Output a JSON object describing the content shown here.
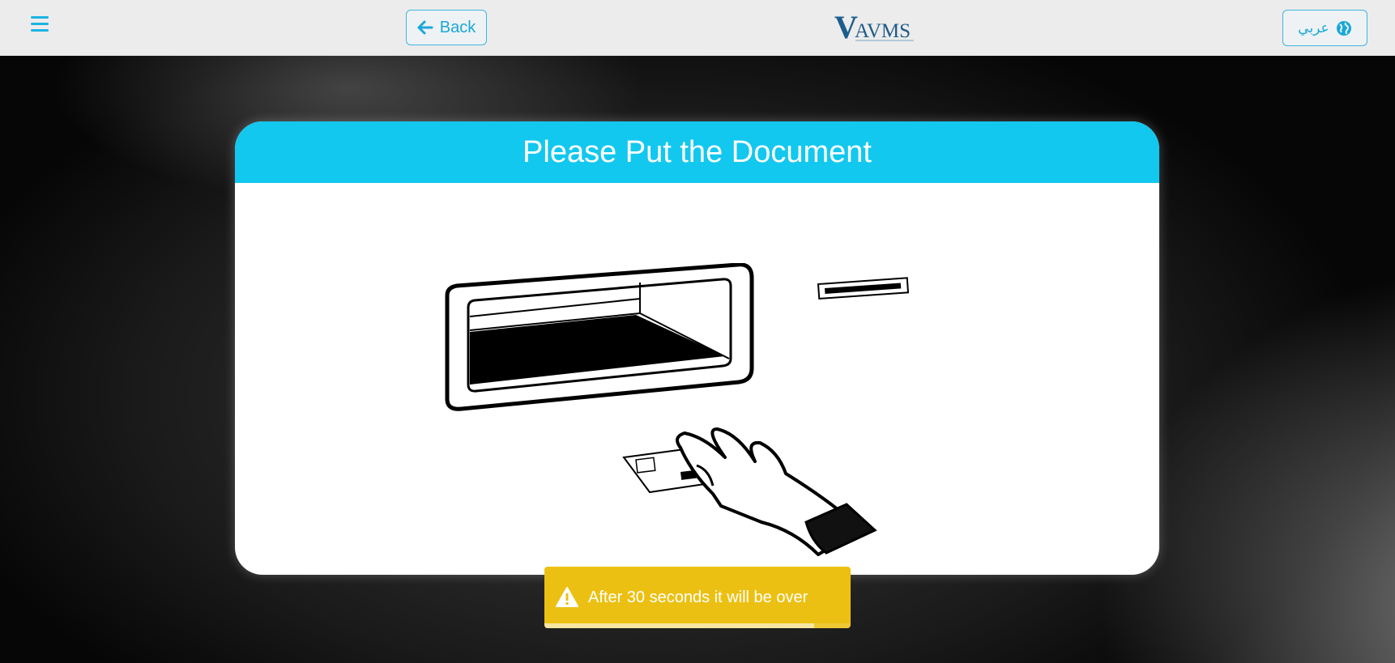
{
  "header": {
    "back_label": "Back",
    "language_label": "عربي",
    "logo_text": "VAVMS"
  },
  "card": {
    "title": "Please Put the Document"
  },
  "toast": {
    "message": "After 30 seconds it will be over",
    "progress": 0.88
  },
  "colors": {
    "accent": "#12c8ef",
    "button_border": "#3fb6df",
    "warning": "#ecc012"
  },
  "icons": [
    "menu-icon",
    "arrow-left-icon",
    "globe-icon",
    "warning-icon"
  ]
}
